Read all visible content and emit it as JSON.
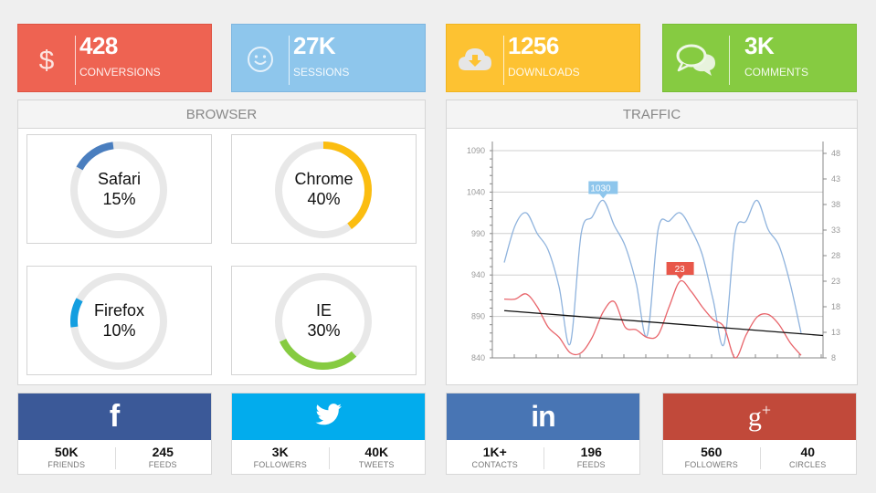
{
  "stats": [
    {
      "value": "428",
      "label": "CONVERSIONS",
      "icon": "dollar-icon",
      "color": "#ee6352"
    },
    {
      "value": "27K",
      "label": "SESSIONS",
      "icon": "smiley-icon",
      "color": "#8ec6ec"
    },
    {
      "value": "1256",
      "label": "DOWNLOADS",
      "icon": "cloud-download-icon",
      "color": "#fdc232"
    },
    {
      "value": "3K",
      "label": "COMMENTS",
      "icon": "speech-bubbles-icon",
      "color": "#86cb41"
    }
  ],
  "browser": {
    "title": "BROWSER",
    "items": [
      {
        "name": "Safari",
        "percent_label": "15%",
        "percent": 15,
        "color": "#4a7ebf"
      },
      {
        "name": "Chrome",
        "percent_label": "40%",
        "percent": 40,
        "color": "#fbbd10"
      },
      {
        "name": "Firefox",
        "percent_label": "10%",
        "percent": 10,
        "color": "#139ee0"
      },
      {
        "name": "IE",
        "percent_label": "30%",
        "percent": 30,
        "color": "#86cb41"
      }
    ]
  },
  "traffic": {
    "title": "TRAFFIC"
  },
  "chart_data": {
    "type": "line",
    "title": "TRAFFIC",
    "xlabel": "",
    "ylabel": "",
    "grid": true,
    "y_left": {
      "range": [
        840,
        1090
      ],
      "ticks": [
        840,
        890,
        940,
        990,
        1040,
        1090
      ]
    },
    "y_right": {
      "range": [
        8,
        48
      ],
      "ticks": [
        8,
        13,
        18,
        23,
        28,
        33,
        38,
        43,
        48
      ]
    },
    "x_count": 28,
    "series": [
      {
        "name": "series-blue",
        "axis": "left",
        "color": "#8fb3dd",
        "values": [
          955,
          1000,
          1015,
          990,
          970,
          925,
          857,
          990,
          1010,
          1030,
          1000,
          975,
          930,
          867,
          995,
          1005,
          1015,
          995,
          965,
          910,
          857,
          990,
          1005,
          1030,
          995,
          975,
          930,
          870
        ]
      },
      {
        "name": "series-red",
        "axis": "right",
        "color": "#e8646a",
        "values": [
          19.5,
          19.5,
          20.5,
          18,
          14,
          12,
          9,
          9,
          12,
          17,
          19,
          14,
          13.5,
          12,
          12.5,
          18,
          23,
          21,
          18,
          15.5,
          14,
          8,
          12.5,
          16,
          16.5,
          14.5,
          11,
          8.5
        ]
      },
      {
        "name": "trend-line",
        "axis": "left",
        "color": "#111111",
        "values_start_end": [
          897,
          867
        ]
      }
    ],
    "annotations": [
      {
        "series": "series-blue",
        "index": 9,
        "label": "1030",
        "color": "#8ec6ec"
      },
      {
        "series": "series-red",
        "index": 16,
        "label": "23",
        "color": "#e8574a"
      }
    ]
  },
  "social": [
    {
      "network": "Facebook",
      "icon": "facebook-icon",
      "glyph": "f",
      "color": "#3b5998",
      "stats": [
        {
          "value": "50K",
          "label": "FRIENDS"
        },
        {
          "value": "245",
          "label": "FEEDS"
        }
      ]
    },
    {
      "network": "Twitter",
      "icon": "twitter-icon",
      "glyph": "",
      "color": "#02aced",
      "stats": [
        {
          "value": "3K",
          "label": "FOLLOWERS"
        },
        {
          "value": "40K",
          "label": "TWEETS"
        }
      ]
    },
    {
      "network": "LinkedIn",
      "icon": "linkedin-icon",
      "glyph": "in",
      "color": "#4875b4",
      "stats": [
        {
          "value": "1K+",
          "label": "CONTACTS"
        },
        {
          "value": "196",
          "label": "FEEDS"
        }
      ]
    },
    {
      "network": "Google Plus",
      "icon": "google-plus-icon",
      "glyph": "g+",
      "color": "#c1493a",
      "stats": [
        {
          "value": "560",
          "label": "FOLLOWERS"
        },
        {
          "value": "40",
          "label": "CIRCLES"
        }
      ]
    }
  ]
}
